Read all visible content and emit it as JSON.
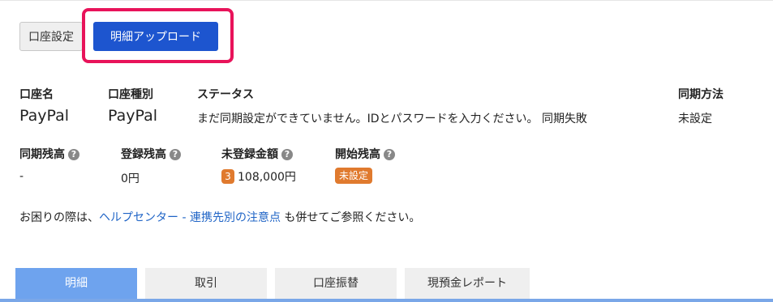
{
  "toolbar": {
    "account_settings_label": "口座設定",
    "upload_label": "明細アップロード"
  },
  "account": {
    "headers": {
      "name": "口座名",
      "type": "口座種別",
      "status": "ステータス",
      "sync_method": "同期方法"
    },
    "name": "PayPal",
    "type": "PayPal",
    "status": "まだ同期設定ができていません。IDとパスワードを入力ください。 同期失敗",
    "sync_method": "未設定"
  },
  "balances": {
    "headers": {
      "sync_balance": "同期残高",
      "registered_balance": "登録残高",
      "unregistered_amount": "未登録金額",
      "opening_balance": "開始残高"
    },
    "sync_balance": "-",
    "registered_balance": "0円",
    "unregistered_count": "3",
    "unregistered_amount": "108,000円",
    "opening_balance": "未設定"
  },
  "help_note": {
    "prefix": "お困りの際は、",
    "link1": "ヘルプセンター",
    "separator": " - ",
    "link2": "連携先別の注意点",
    "suffix": " も併せてご参照ください。"
  },
  "tabs": [
    {
      "label": "明細",
      "active": true
    },
    {
      "label": "取引",
      "active": false
    },
    {
      "label": "口座振替",
      "active": false
    },
    {
      "label": "現預金レポート",
      "active": false
    }
  ],
  "colors": {
    "primary": "#1d55cf",
    "highlight": "#e8135a",
    "badge": "#e07a2e",
    "link": "#1f64c6",
    "active_tab": "#6ea3ee"
  }
}
